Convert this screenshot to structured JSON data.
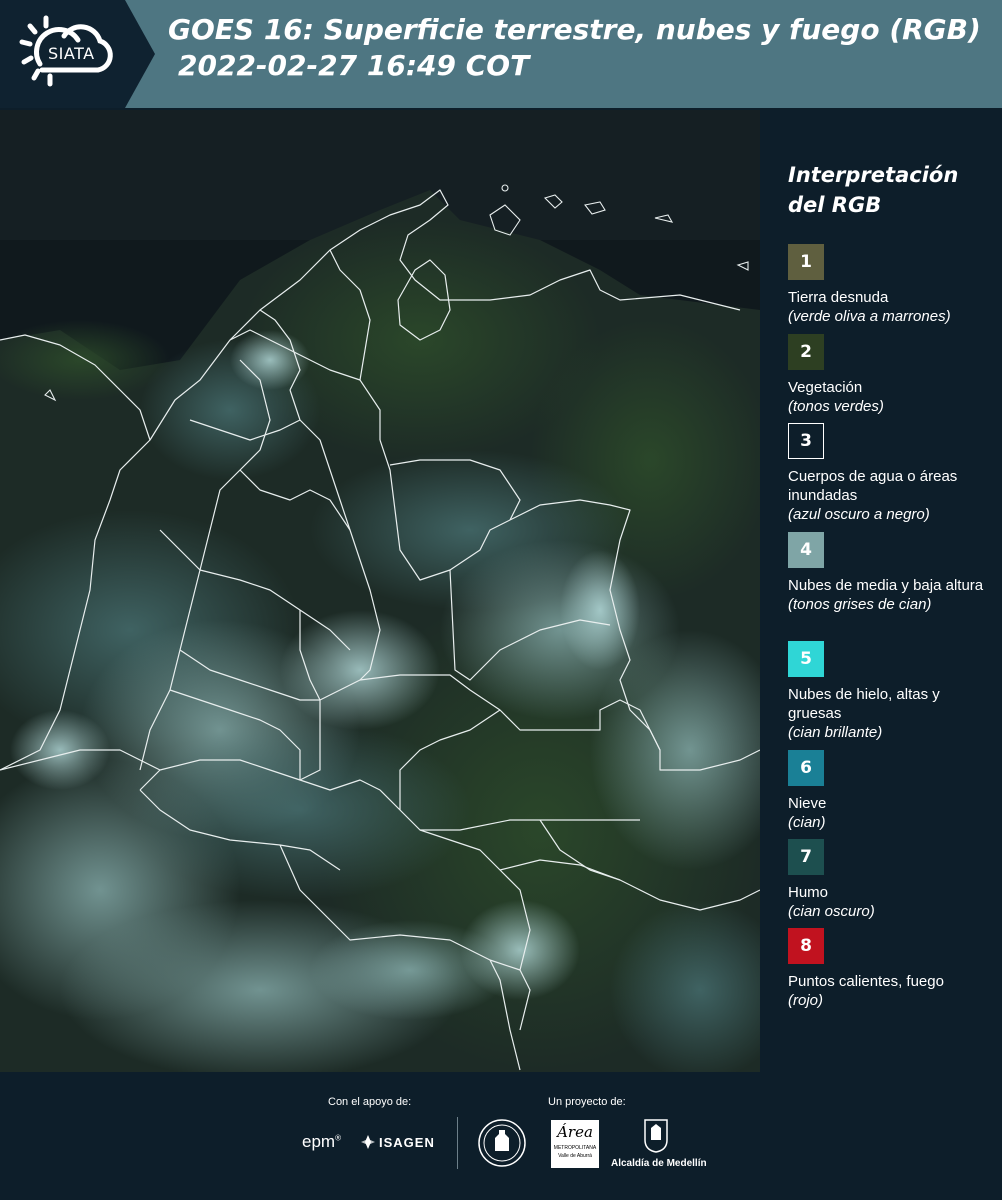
{
  "header": {
    "logo_text": "SIATA",
    "title_line1": "GOES 16: Superficie terrestre, nubes y fuego (RGB)",
    "title_line2": "2022-02-27 16:49 COT"
  },
  "legend": {
    "title_line1": "Interpretación",
    "title_line2": "del RGB",
    "items": [
      {
        "number": "1",
        "label": "Tierra desnuda",
        "desc": "(verde oliva a marrones)",
        "color": "#5f5f3f",
        "text_color": "#ffffff"
      },
      {
        "number": "2",
        "label": "Vegetación",
        "desc": "(tonos verdes)",
        "color": "#2d3f22",
        "text_color": "#ffffff"
      },
      {
        "number": "3",
        "label": "Cuerpos de agua o áreas inundadas",
        "desc": "(azul oscuro a negro)",
        "color": "#0d1e2a",
        "text_color": "#ffffff"
      },
      {
        "number": "4",
        "label": "Nubes de media y baja altura",
        "desc": "(tonos grises de cian)",
        "color": "#7fa5a6",
        "text_color": "#ffffff"
      },
      {
        "number": "5",
        "label": "Nubes de hielo, altas y gruesas",
        "desc": "(cian brillante)",
        "color": "#2fd6d6",
        "text_color": "#ffffff"
      },
      {
        "number": "6",
        "label": "Nieve",
        "desc": "(cian)",
        "color": "#1a8096",
        "text_color": "#ffffff"
      },
      {
        "number": "7",
        "label": "Humo",
        "desc": "(cian oscuro)",
        "color": "#1d4f4f",
        "text_color": "#ffffff"
      },
      {
        "number": "8",
        "label": "Puntos calientes, fuego",
        "desc": "(rojo)",
        "color": "#c1121f",
        "text_color": "#ffffff"
      }
    ]
  },
  "footer": {
    "support_label": "Con el apoyo de:",
    "project_label": "Un proyecto de:",
    "sponsor_epm": "epm",
    "sponsor_isagen": "ISAGEN",
    "area_text": "Área",
    "area_sub": "METROPOLITANA",
    "area_sub2": "Valle de Aburrá",
    "alcaldia": "Alcaldía de Medellín"
  }
}
